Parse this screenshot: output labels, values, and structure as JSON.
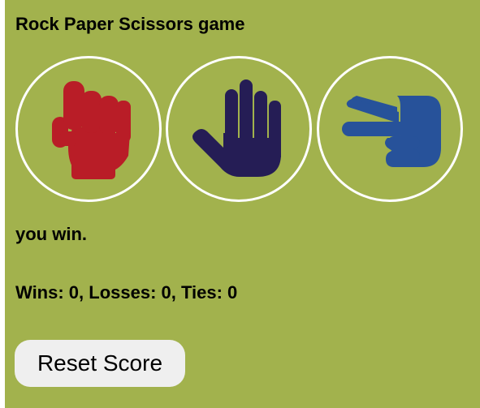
{
  "title": "Rock Paper Scissors game",
  "choices": [
    {
      "label": "rock",
      "icon": "fist-icon",
      "color": "#b91d27"
    },
    {
      "label": "paper",
      "icon": "open-hand-icon",
      "color": "#251d55"
    },
    {
      "label": "scissors",
      "icon": "hand-scissors-icon",
      "color": "#27529a"
    }
  ],
  "result": "you win.",
  "score": "Wins: 0, Losses: 0, Ties: 0",
  "reset_button_label": "Reset Score",
  "colors": {
    "background": "#a2b24d",
    "circle_border": "#ffffff",
    "button_background": "#efefef"
  }
}
